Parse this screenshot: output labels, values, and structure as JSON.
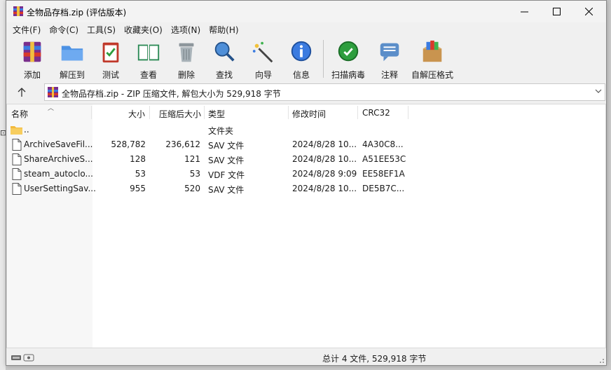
{
  "window": {
    "title": "全物品存档.zip (评估版本)",
    "controls": {
      "minimize": "minimize",
      "maximize": "maximize",
      "close": "close"
    }
  },
  "menu": [
    "文件(F)",
    "命令(C)",
    "工具(S)",
    "收藏夹(O)",
    "选项(N)",
    "帮助(H)"
  ],
  "toolbar": [
    {
      "label": "添加",
      "icon": "add-archive-icon"
    },
    {
      "label": "解压到",
      "icon": "extract-to-folder-icon"
    },
    {
      "label": "测试",
      "icon": "test-clipboard-icon"
    },
    {
      "label": "查看",
      "icon": "view-book-icon"
    },
    {
      "label": "删除",
      "icon": "delete-trash-icon"
    },
    {
      "label": "查找",
      "icon": "find-magnifier-icon"
    },
    {
      "label": "向导",
      "icon": "wizard-wand-icon"
    },
    {
      "label": "信息",
      "icon": "info-icon"
    },
    {
      "label": "扫描病毒",
      "icon": "virus-scan-icon"
    },
    {
      "label": "注释",
      "icon": "comment-icon"
    },
    {
      "label": "自解压格式",
      "icon": "sfx-box-icon"
    }
  ],
  "address": {
    "text": "全物品存档.zip - ZIP 压缩文件, 解包大小为 529,918 字节"
  },
  "columns": {
    "name": "名称",
    "size": "大小",
    "packed": "压缩后大小",
    "type": "类型",
    "modified": "修改时间",
    "crc": "CRC32"
  },
  "files": [
    {
      "name": "..",
      "size": "",
      "packed": "",
      "type": "文件夹",
      "modified": "",
      "crc": "",
      "icon": "folder-icon"
    },
    {
      "name": "ArchiveSaveFil...",
      "size": "528,782",
      "packed": "236,612",
      "type": "SAV 文件",
      "modified": "2024/8/28 10...",
      "crc": "4A30C8...",
      "icon": "file-icon"
    },
    {
      "name": "ShareArchiveS...",
      "size": "128",
      "packed": "121",
      "type": "SAV 文件",
      "modified": "2024/8/28 10...",
      "crc": "A51EE53C",
      "icon": "file-icon"
    },
    {
      "name": "steam_autoclo...",
      "size": "53",
      "packed": "53",
      "type": "VDF 文件",
      "modified": "2024/8/28 9:09",
      "crc": "EE58EF1A",
      "icon": "file-icon"
    },
    {
      "name": "UserSettingSav...",
      "size": "955",
      "packed": "520",
      "type": "SAV 文件",
      "modified": "2024/8/28 10...",
      "crc": "DE5B7C...",
      "icon": "file-icon"
    }
  ],
  "status": {
    "summary": "总计 4 文件, 529,918 字节"
  },
  "colors": {
    "accent_blue": "#1e6fd9",
    "folder_yellow": "#f2b93b",
    "window_bg": "#f0f0f0"
  }
}
